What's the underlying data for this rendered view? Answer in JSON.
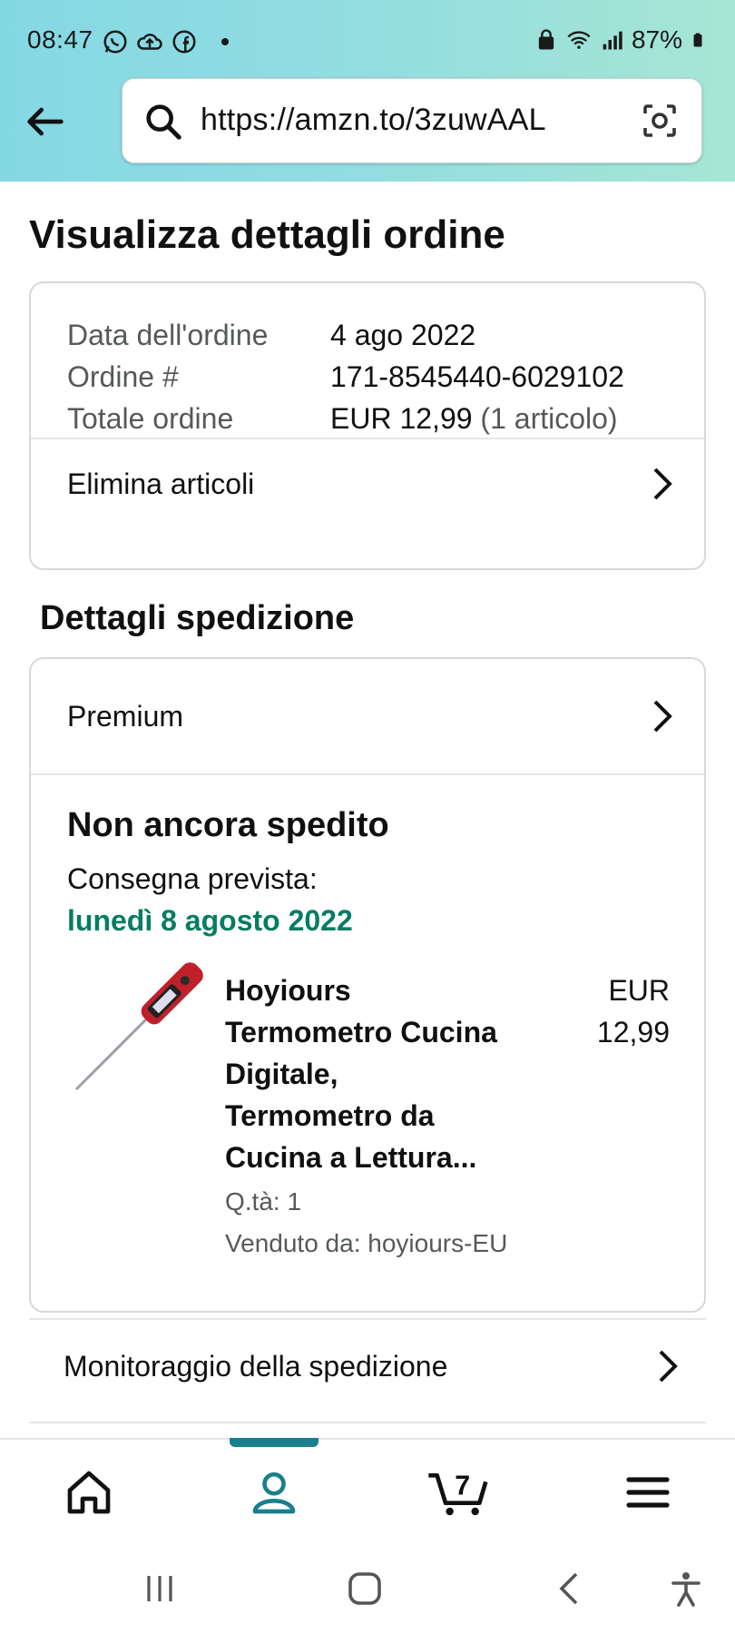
{
  "status_bar": {
    "time": "08:47",
    "battery": "87%",
    "icons_left": [
      "whatsapp-icon",
      "cloud-upload-icon",
      "facebook-icon",
      "dot"
    ],
    "icons_right": [
      "lock-icon",
      "wifi-icon",
      "signal-icon",
      "battery-icon"
    ]
  },
  "browser": {
    "url": "https://amzn.to/3zuwAAL"
  },
  "page": {
    "title": "Visualizza dettagli ordine"
  },
  "order": {
    "rows": [
      {
        "label": "Data dell'ordine",
        "value": "4 ago 2022"
      },
      {
        "label": "Ordine #",
        "value": "171-8545440-6029102"
      },
      {
        "label": "Totale ordine",
        "value": "EUR 12,99",
        "extra": "(1 articolo)"
      }
    ],
    "delete_items": "Elimina articoli"
  },
  "shipping": {
    "section_title": "Dettagli spedizione",
    "method": "Premium",
    "status": "Non ancora spedito",
    "expected_label": "Consegna prevista:",
    "expected_date": "lunedì 8 agosto 2022",
    "product": {
      "title_lines": [
        "Hoyiours",
        "Termometro Cucina",
        "Digitale,",
        "Termometro da",
        "Cucina a Lettura..."
      ],
      "price_currency": "EUR",
      "price_value": "12,99",
      "quantity": "Q.tà: 1",
      "seller": "Venduto da: hoyiours-EU"
    },
    "tracking": "Monitoraggio della spedizione"
  },
  "bottom_nav": {
    "items": [
      "home-icon",
      "account-icon",
      "cart-icon",
      "menu-icon"
    ],
    "cart_count": "7",
    "active": "account"
  },
  "colors": {
    "delivery_green": "#067d62",
    "nav_active": "#1a7f8c",
    "header_gradient_start": "#84d8e4",
    "header_gradient_end": "#a6e6d4"
  }
}
